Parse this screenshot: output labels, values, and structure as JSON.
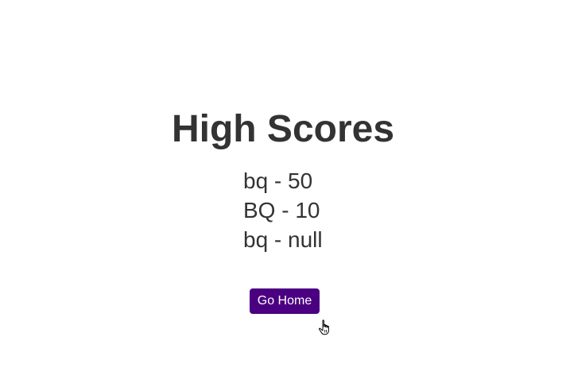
{
  "page": {
    "title": "High Scores"
  },
  "scores": [
    {
      "text": "bq - 50"
    },
    {
      "text": "BQ - 10"
    },
    {
      "text": "bq - null"
    }
  ],
  "actions": {
    "go_home_label": "Go Home"
  },
  "colors": {
    "accent": "#4b0082",
    "text": "#333333",
    "background": "#ffffff"
  },
  "icons": {
    "cursor": "hand-pointer-icon"
  }
}
